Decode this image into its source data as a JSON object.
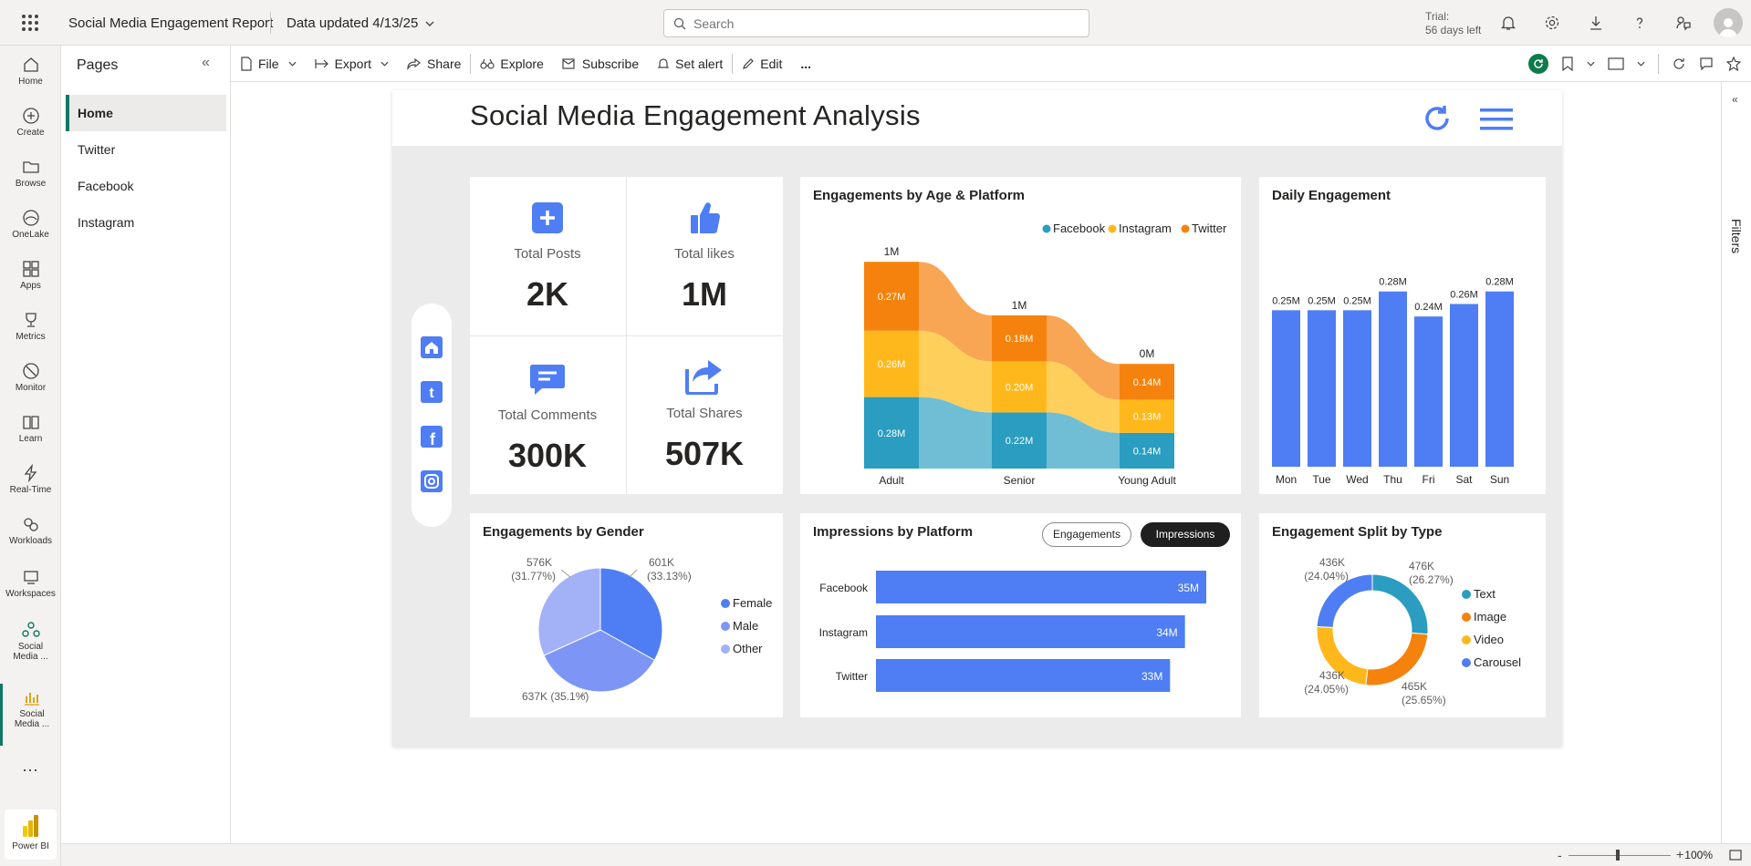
{
  "topbar": {
    "report_title": "Social Media Engagement Report",
    "data_updated": "Data updated 4/13/25",
    "search_placeholder": "Search",
    "trial_line1": "Trial:",
    "trial_line2": "56 days left"
  },
  "rail": {
    "items": [
      {
        "label": "Home",
        "icon": "home-icon"
      },
      {
        "label": "Create",
        "icon": "create-icon"
      },
      {
        "label": "Browse",
        "icon": "browse-icon"
      },
      {
        "label": "OneLake",
        "icon": "onelake-icon"
      },
      {
        "label": "Apps",
        "icon": "apps-icon"
      },
      {
        "label": "Metrics",
        "icon": "metrics-icon"
      },
      {
        "label": "Monitor",
        "icon": "monitor-icon"
      },
      {
        "label": "Learn",
        "icon": "learn-icon"
      },
      {
        "label": "Real-Time",
        "icon": "realtime-icon"
      },
      {
        "label": "Workloads",
        "icon": "workloads-icon"
      },
      {
        "label": "Workspaces",
        "icon": "workspaces-icon"
      }
    ],
    "workspace_item": {
      "line1": "Social",
      "line2": "Media ..."
    },
    "report_item": {
      "line1": "Social",
      "line2": "Media ..."
    },
    "more": "...",
    "powerbi_label": "Power BI"
  },
  "pages": {
    "title": "Pages",
    "items": [
      "Home",
      "Twitter",
      "Facebook",
      "Instagram"
    ],
    "active": "Home"
  },
  "actionbar": {
    "file": "File",
    "export": "Export",
    "share": "Share",
    "explore": "Explore",
    "subscribe": "Subscribe",
    "set_alert": "Set alert",
    "edit": "Edit",
    "more": "..."
  },
  "report": {
    "heading": "Social Media Engagement Analysis",
    "kpis": [
      {
        "label": "Total Posts",
        "value": "2K",
        "icon": "plus-square-icon"
      },
      {
        "label": "Total likes",
        "value": "1M",
        "icon": "thumbs-up-icon"
      },
      {
        "label": "Total Comments",
        "value": "300K",
        "icon": "comment-icon"
      },
      {
        "label": "Total Shares",
        "value": "507K",
        "icon": "share-arrow-icon"
      }
    ],
    "nav_buttons": [
      "home-icon",
      "twitter-icon",
      "facebook-icon",
      "instagram-icon"
    ],
    "toggle": {
      "engagements": "Engagements",
      "impressions": "Impressions",
      "active": "Impressions"
    }
  },
  "colors": {
    "accent_blue": "#4F7DF3",
    "facebook_teal": "#2A9DC0",
    "instagram_yellow": "#FFB81C",
    "twitter_orange": "#F5820D",
    "carousel_blue": "#4F7DF3",
    "male_blue": "#7D96F5",
    "other_blue": "#A3B1F7",
    "pbi_green": "#117865"
  },
  "chart_data": [
    {
      "id": "age_platform",
      "type": "area",
      "title": "Engagements by Age & Platform",
      "categories": [
        "Adult",
        "Senior",
        "Young Adult"
      ],
      "totals": [
        "1M",
        "1M",
        "0M"
      ],
      "series": [
        {
          "name": "Facebook",
          "values": [
            0.28,
            0.22,
            0.14
          ],
          "labels": [
            "0.28M",
            "0.22M",
            "0.14M"
          ]
        },
        {
          "name": "Instagram",
          "values": [
            0.26,
            0.2,
            0.13
          ],
          "labels": [
            "0.26M",
            "0.20M",
            "0.13M"
          ]
        },
        {
          "name": "Twitter",
          "values": [
            0.27,
            0.18,
            0.14
          ],
          "labels": [
            "0.27M",
            "0.18M",
            "0.14M"
          ]
        }
      ],
      "legend": "top-right"
    },
    {
      "id": "daily",
      "type": "bar",
      "title": "Daily Engagement",
      "categories": [
        "Mon",
        "Tue",
        "Wed",
        "Thu",
        "Fri",
        "Sat",
        "Sun"
      ],
      "values": [
        0.25,
        0.25,
        0.25,
        0.28,
        0.24,
        0.26,
        0.28
      ],
      "labels": [
        "0.25M",
        "0.25M",
        "0.25M",
        "0.28M",
        "0.24M",
        "0.26M",
        "0.28M"
      ]
    },
    {
      "id": "gender",
      "type": "pie",
      "title": "Engagements by Gender",
      "slices": [
        {
          "name": "Female",
          "value": 601,
          "label1": "601K",
          "label2": "(33.13%)"
        },
        {
          "name": "Male",
          "value": 637,
          "label1": "637K (35.1%)",
          "label2": ""
        },
        {
          "name": "Other",
          "value": 576,
          "label1": "576K",
          "label2": "(31.77%)"
        }
      ],
      "legend": "right"
    },
    {
      "id": "impressions",
      "type": "bar",
      "orientation": "horizontal",
      "title": "Impressions by Platform",
      "categories": [
        "Facebook",
        "Instagram",
        "Twitter"
      ],
      "values": [
        35,
        34,
        33
      ],
      "labels": [
        "35M",
        "34M",
        "33M"
      ]
    },
    {
      "id": "type_split",
      "type": "pie",
      "donut": true,
      "title": "Engagement Split by Type",
      "slices": [
        {
          "name": "Text",
          "value": 476,
          "label1": "476K",
          "label2": "(26.27%)"
        },
        {
          "name": "Image",
          "value": 465,
          "label1": "465K",
          "label2": "(25.65%)"
        },
        {
          "name": "Video",
          "value": 436,
          "label1": "436K",
          "label2": "(24.05%)"
        },
        {
          "name": "Carousel",
          "value": 436,
          "label1": "436K",
          "label2": "(24.04%)"
        }
      ],
      "legend": "right"
    }
  ],
  "footer": {
    "zoom": "100%"
  },
  "filters_label": "Filters"
}
